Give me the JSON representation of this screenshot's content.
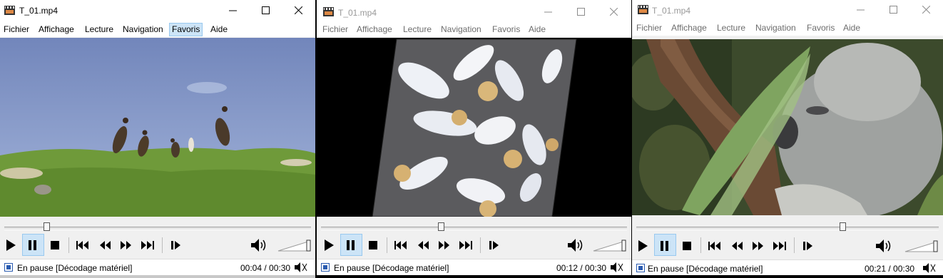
{
  "windows": [
    {
      "title": "T_01.mp4",
      "menu": [
        "Fichier",
        "Affichage",
        "Lecture",
        "Navigation",
        "Favoris",
        "Aide"
      ],
      "selected_menu": "Favoris",
      "status": "En pause [Décodage matériel]",
      "time": "00:04 / 00:30",
      "progress": 0.13,
      "video_description": "birds-on-grass"
    },
    {
      "title": "T_01.mp4",
      "menu": [
        "Fichier",
        "Affichage",
        "Lecture",
        "Navigation",
        "Favoris",
        "Aide"
      ],
      "selected_menu": "",
      "status": "En pause [Décodage matériel]",
      "time": "00:12 / 00:30",
      "progress": 0.4,
      "video_description": "gannets-rotated"
    },
    {
      "title": "T_01.mp4",
      "menu": [
        "Fichier",
        "Affichage",
        "Lecture",
        "Navigation",
        "Favoris",
        "Aide"
      ],
      "selected_menu": "",
      "status": "En pause [Décodage matériel]",
      "time": "00:21 / 00:30",
      "progress": 0.7,
      "video_description": "koala-in-tree"
    }
  ],
  "colors": {
    "selection_bg": "#cce4f7",
    "selection_border": "#99c9ef",
    "sky": "#7f93c2",
    "grass": "#6f9a3a"
  },
  "icons": [
    "app-icon",
    "minimize-icon",
    "maximize-icon",
    "close-icon",
    "play-icon",
    "pause-icon",
    "stop-icon",
    "skip-back-icon",
    "rewind-icon",
    "fast-forward-icon",
    "skip-forward-icon",
    "frame-step-icon",
    "volume-icon"
  ]
}
